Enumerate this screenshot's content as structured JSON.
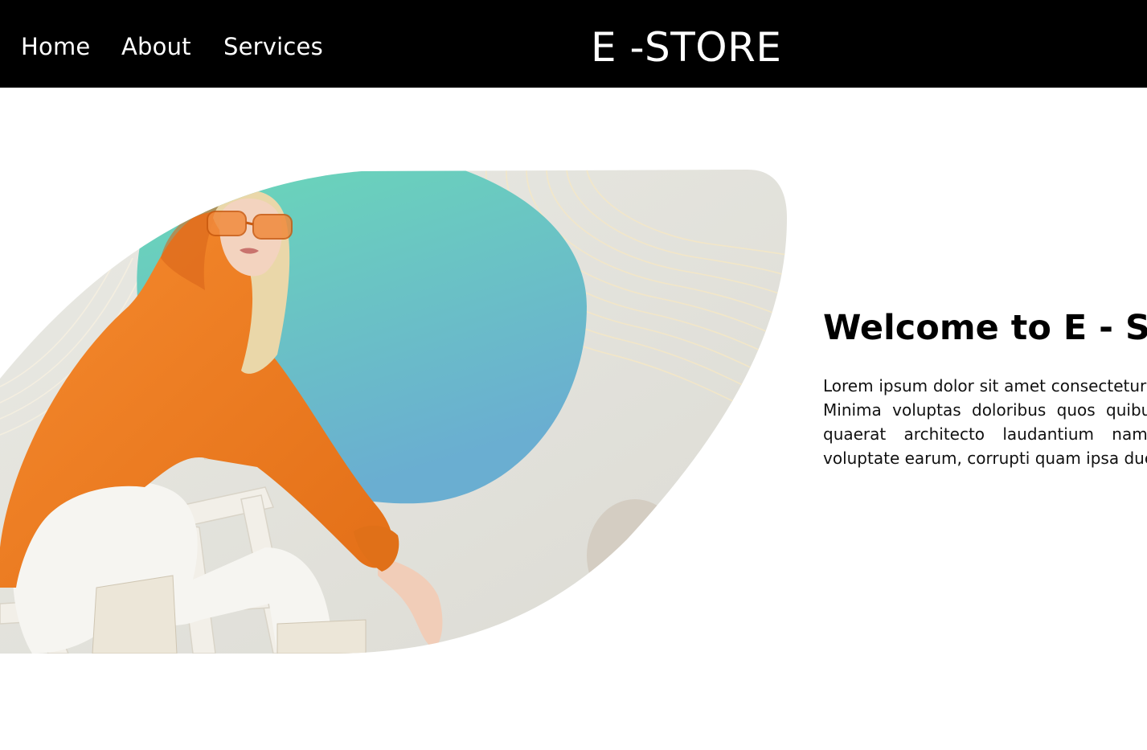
{
  "nav": {
    "links": [
      {
        "label": "Home"
      },
      {
        "label": "About"
      },
      {
        "label": "Services"
      }
    ],
    "brand": "E -STORE"
  },
  "hero": {
    "image_subject": "woman in orange hoodie and orange sunglasses sitting on white chair",
    "colors": {
      "hoodie": "#f07f24",
      "circle_top": "#6adbb6",
      "circle_bottom": "#6aaed1",
      "backdrop": "#e6e5df"
    },
    "welcome_title": "Welcome to E - STORE",
    "welcome_text": "Lorem ipsum dolor sit amet consectetur adipisicing elit. Minima voluptas doloribus quos quibusdam rem est quaerat architecto laudantium nam velit, eaque voluptate earum, corrupti quam ipsa ducimus nostrum."
  },
  "colors": {
    "navbar_bg": "#000000",
    "navbar_text": "#ffffff",
    "page_bg": "#ffffff"
  }
}
